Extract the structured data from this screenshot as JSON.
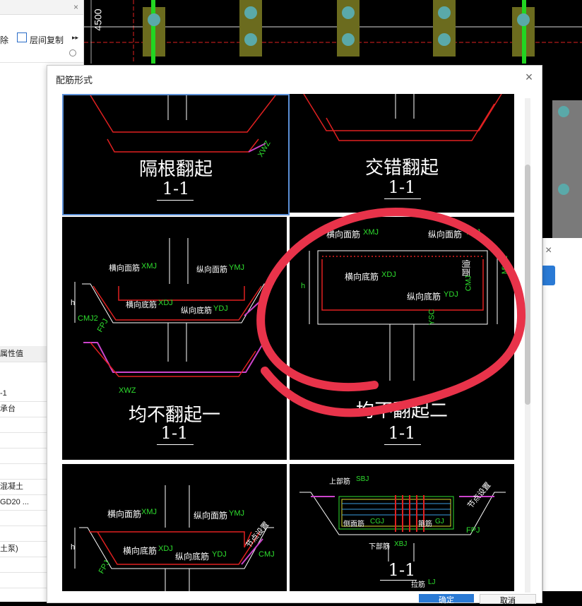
{
  "left_panel": {
    "toolbar": {
      "delete_label": "除",
      "copy_label": "层间复制",
      "more_label": "▸▸"
    },
    "props_header": "属性值",
    "props_values": [
      "-1",
      "承台",
      "",
      "",
      "",
      "",
      "混凝土",
      "GD20 ...",
      "",
      "",
      "土泵)",
      "",
      ""
    ]
  },
  "cad": {
    "dimension_label": "4500"
  },
  "dialog": {
    "title": "配筋形式",
    "close_label": "×",
    "options": [
      {
        "name": "隔根翻起",
        "section": "1-1",
        "selected": true
      },
      {
        "name": "交错翻起",
        "section": "1-1",
        "selected": false
      },
      {
        "name": "均不翻起一",
        "section": "1-1",
        "selected": false
      },
      {
        "name": "均不翻起二",
        "section": "1-1",
        "selected": false
      },
      {
        "name": "",
        "section": "",
        "selected": false
      },
      {
        "name": "",
        "section": "1-1",
        "selected": false
      }
    ],
    "labels": {
      "hor_top": "横向面筋",
      "hor_top_code": "XMJ",
      "ver_top": "纵向面筋",
      "ver_top_code": "YMJ",
      "hor_bot": "横向底筋",
      "hor_bot_code": "XDJ",
      "ver_bot": "纵向底筋",
      "ver_bot_code": "YDJ",
      "side": "侧面",
      "side_code": "CMJ",
      "cmj2": "CMJ2",
      "fpj": "FPJ",
      "xwz": "XWZ",
      "mwz": "MWZ",
      "ysc": "YSC",
      "cmj1": "CMJ",
      "slope_a": "节点设置",
      "top_bar": "上部筋",
      "top_bar_code": "SBJ",
      "side_bar": "侧面筋",
      "side_bar_code": "CGJ",
      "stirrup": "箍筋",
      "stirrup_code": "GJ",
      "bot_bar": "下部筋",
      "bot_bar_code": "XBJ",
      "tie_bar": "拉筋",
      "tie_bar_code": "LJ",
      "h": "h"
    },
    "ok_label": "确定",
    "cancel_label": "取消"
  }
}
